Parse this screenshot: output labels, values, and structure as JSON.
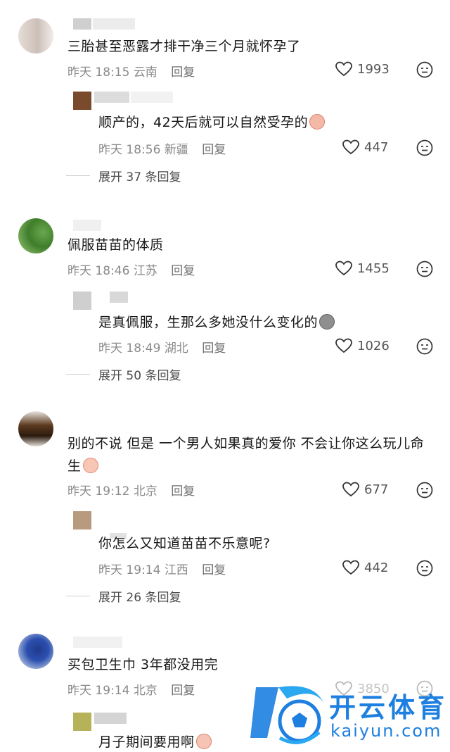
{
  "comments": [
    {
      "text": "三胎甚至恶露才排干净三个月就怀孕了",
      "time": "昨天 18:15",
      "location": "云南",
      "reply_label": "回复",
      "likes": "1993",
      "replies": [
        {
          "text": "顺产的，42天后就可以自然受孕的",
          "time": "昨天 18:56",
          "location": "新疆",
          "reply_label": "回复",
          "likes": "447"
        }
      ],
      "expand_label": "展开 37 条回复"
    },
    {
      "text": "佩服苗苗的体质",
      "time": "昨天 18:46",
      "location": "江苏",
      "reply_label": "回复",
      "likes": "1455",
      "replies": [
        {
          "text": "是真佩服，生那么多她没什么变化的",
          "time": "昨天 18:49",
          "location": "湖北",
          "reply_label": "回复",
          "likes": "1026"
        }
      ],
      "expand_label": "展开 50 条回复"
    },
    {
      "text_line1": "别的不说 但是 一个男人如果真的爱你 不会让你这么玩儿命",
      "text_line2": "生",
      "time": "昨天 19:12",
      "location": "北京",
      "reply_label": "回复",
      "likes": "677",
      "replies": [
        {
          "text": "你怎么又知道苗苗不乐意呢?",
          "time": "昨天 19:14",
          "location": "江西",
          "reply_label": "回复",
          "likes": "442"
        }
      ],
      "expand_label": "展开 26 条回复"
    },
    {
      "text": "买包卫生巾 3年都没用完",
      "time": "昨天 19:14",
      "location": "北京",
      "reply_label": "回复",
      "likes": "3850",
      "replies": [
        {
          "text": "月子期间要用啊"
        }
      ]
    }
  ],
  "icons": {
    "like": "heart-outline-icon",
    "emoji": "neutral-face-icon"
  },
  "watermark": {
    "brand": "开云体育",
    "url": "kaiyun.com"
  },
  "colors": {
    "meta": "#8a8a8a",
    "text": "#161616",
    "watermark": "#1d7fe0"
  }
}
